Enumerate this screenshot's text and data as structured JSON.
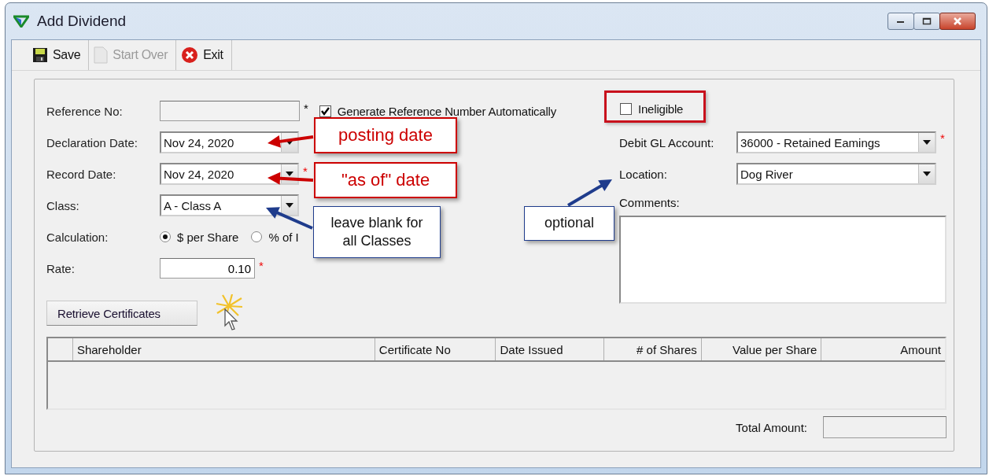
{
  "window": {
    "title": "Add Dividend"
  },
  "toolbar": [
    {
      "label": "Save",
      "kind": "save",
      "disabled": false
    },
    {
      "label": "Start Over",
      "kind": "new",
      "disabled": true
    },
    {
      "label": "Exit",
      "kind": "exit",
      "disabled": false
    }
  ],
  "form": {
    "reference_no": {
      "label": "Reference No:",
      "disabled": true,
      "marker": "*"
    },
    "generate_reference": {
      "label": "Generate Reference Number Automatically",
      "checked": true
    },
    "declaration_date": {
      "label": "Declaration Date:",
      "value": "Nov 24, 2020"
    },
    "record_date": {
      "label": "Record Date:",
      "value": "Nov 24, 2020",
      "marker": "*"
    },
    "class": {
      "label": "Class:",
      "value": "A - Class A"
    },
    "calculation": {
      "label": "Calculation:",
      "options": [
        {
          "label": "$ per Share",
          "selected": true
        },
        {
          "label": "% of I",
          "selected": false
        }
      ]
    },
    "rate": {
      "label": "Rate:",
      "value": "0.10",
      "marker": "*"
    },
    "ineligible": {
      "label": "Ineligible",
      "checked": false
    },
    "debit_gl_account": {
      "label": "Debit GL Account:",
      "value": "36000 - Retained Eamings",
      "marker": "*"
    },
    "location": {
      "label": "Location:",
      "value": "Dog River"
    },
    "comments": {
      "label": "Comments:"
    }
  },
  "retrieve_button": "Retrieve Certificates",
  "table": {
    "columns": [
      {
        "label": "Shareholder",
        "kind": "text"
      },
      {
        "label": "Certificate No",
        "kind": "text"
      },
      {
        "label": "Date Issued",
        "kind": "text"
      },
      {
        "label": "# of Shares",
        "kind": "number"
      },
      {
        "label": "Value per Share",
        "kind": "number"
      },
      {
        "label": "Amount",
        "kind": "number"
      }
    ]
  },
  "total": {
    "label": "Total Amount:"
  },
  "annotations": [
    {
      "text": "posting date",
      "color": "#cc0000"
    },
    {
      "text": "\"as of\" date",
      "color": "#cc0000"
    },
    {
      "text": "leave blank for all Classes",
      "color": "#1f3c8c"
    },
    {
      "text": "optional",
      "color": "#1f3c8c"
    }
  ]
}
